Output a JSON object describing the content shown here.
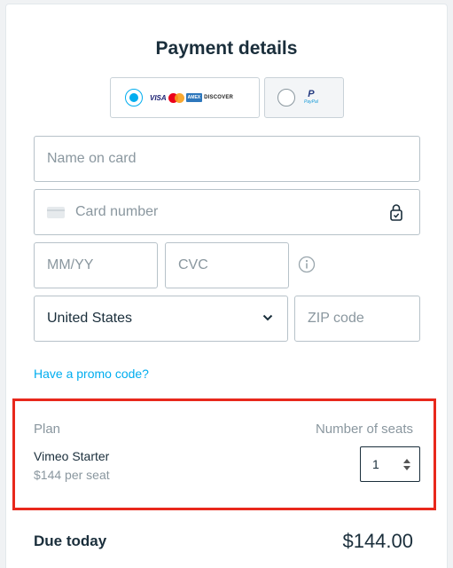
{
  "header": {
    "title": "Payment details"
  },
  "payment_methods": [
    {
      "id": "card",
      "selected": true,
      "logos": [
        "VISA",
        "mastercard",
        "AMEX",
        "DISCOVER"
      ]
    },
    {
      "id": "paypal",
      "selected": false,
      "logo_top": "P",
      "logo_bottom": "PayPal"
    }
  ],
  "form": {
    "name_placeholder": "Name on card",
    "card_number_placeholder": "Card number",
    "expiry_placeholder": "MM/YY",
    "cvc_placeholder": "CVC",
    "country_value": "United States",
    "zip_placeholder": "ZIP code"
  },
  "promo": {
    "link_text": "Have a promo code?"
  },
  "plan": {
    "plan_header": "Plan",
    "seats_header": "Number of seats",
    "name": "Vimeo Starter",
    "price": "$144 per seat",
    "seats_value": "1"
  },
  "summary": {
    "due_label": "Due today",
    "due_amount": "$144.00"
  },
  "colors": {
    "accent": "#00adef",
    "highlight": "#e8281c",
    "text": "#1a2e3b",
    "muted": "#8a979f"
  },
  "icons": [
    "card-icon",
    "lock-icon",
    "info-icon",
    "chevron-down-icon",
    "radio-icon"
  ]
}
